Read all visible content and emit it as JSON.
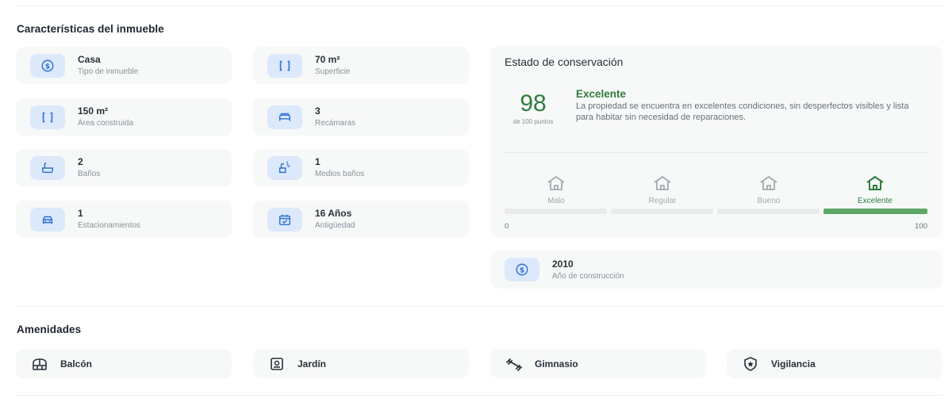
{
  "features_section": {
    "title": "Características del inmueble",
    "items": [
      {
        "value": "Casa",
        "label": "Tipo de inmueble",
        "icon": "dollar-coin-icon"
      },
      {
        "value": "70 m²",
        "label": "Superficie",
        "icon": "brackets-icon"
      },
      {
        "value": "150 m²",
        "label": "Área construida",
        "icon": "brackets-icon"
      },
      {
        "value": "3",
        "label": "Recámaras",
        "icon": "bed-icon"
      },
      {
        "value": "2",
        "label": "Baños",
        "icon": "bathtub-icon"
      },
      {
        "value": "1",
        "label": "Medios baños",
        "icon": "sink-icon"
      },
      {
        "value": "1",
        "label": "Estacionamientos",
        "icon": "car-icon"
      },
      {
        "value": "16 Años",
        "label": "Antigüedad",
        "icon": "calendar-check-icon"
      }
    ]
  },
  "conservation": {
    "title": "Estado de conservación",
    "score": "98",
    "score_sub": "de 100 puntos",
    "rating": "Excelente",
    "description": "La propiedad se encuentra en excelentes condiciones, sin desperfectos visibles y lista para habitar sin necesidad de reparaciones.",
    "levels": [
      {
        "label": "Malo",
        "icon": "house-icon",
        "active": false
      },
      {
        "label": "Regular",
        "icon": "house-icon",
        "active": false
      },
      {
        "label": "Bueno",
        "icon": "house-icon",
        "active": false
      },
      {
        "label": "Excelente",
        "icon": "house-icon",
        "active": true
      }
    ],
    "scale_min": "0",
    "scale_max": "100",
    "filled_segment_index": 3
  },
  "construction_year": {
    "value": "2010",
    "label": "Año de construcción",
    "icon": "dollar-coin-icon"
  },
  "amenities_section": {
    "title": "Amenidades",
    "items": [
      {
        "label": "Balcón",
        "icon": "balcony-icon"
      },
      {
        "label": "Jardín",
        "icon": "garden-icon"
      },
      {
        "label": "Gimnasio",
        "icon": "dumbbell-icon"
      },
      {
        "label": "Vigilancia",
        "icon": "security-badge-icon"
      }
    ]
  },
  "colors": {
    "accent_green": "#2f7d3e",
    "bar_fill": "#5fa968",
    "icon_bg": "#dce9fb",
    "icon_blue": "#2f6fd6",
    "card_bg": "#f7f8f8"
  }
}
